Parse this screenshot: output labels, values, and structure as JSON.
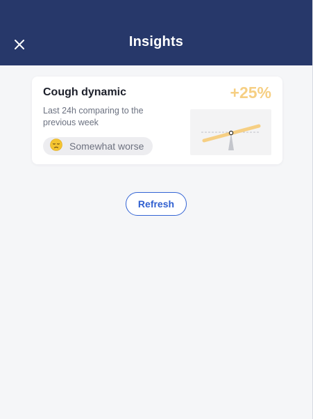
{
  "header": {
    "title": "Insights",
    "close_icon": "close-icon",
    "background": "#27386a"
  },
  "card": {
    "title": "Cough dynamic",
    "subtitle": "Last 24h comparing to the previous week",
    "percent_change": "+25%",
    "status": {
      "emoji": "😔",
      "label": "Somewhat worse"
    },
    "accent_color": "#f6cf83"
  },
  "refresh_button": {
    "label": "Refresh",
    "color": "#3263d4"
  }
}
